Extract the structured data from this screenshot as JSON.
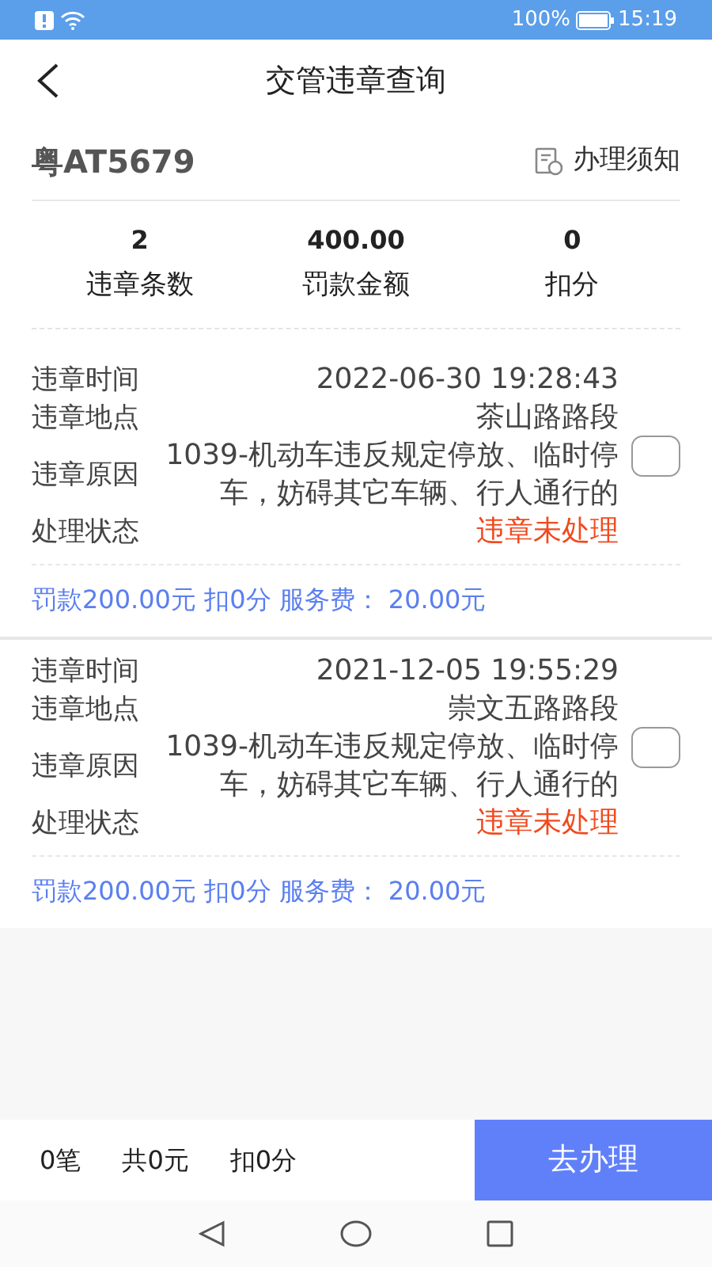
{
  "status_bar": {
    "battery_text": "100%",
    "time": "15:19"
  },
  "header": {
    "title": "交管违章查询"
  },
  "plate": {
    "number": "粤AT5679",
    "notice_link": "办理须知"
  },
  "summary": [
    {
      "value": "2",
      "label": "违章条数"
    },
    {
      "value": "400.00",
      "label": "罚款金额"
    },
    {
      "value": "0",
      "label": "扣分"
    }
  ],
  "violations": [
    {
      "checked": false,
      "fields": [
        {
          "label": "违章时间",
          "value": "2022-06-30 19:28:43",
          "kind": "plain"
        },
        {
          "label": "违章地点",
          "value": "茶山路路段",
          "kind": "plain"
        },
        {
          "label": "违章原因",
          "value": "1039-机动车违反规定停放、临时停车，妨碍其它车辆、行人通行的",
          "kind": "plain"
        },
        {
          "label": "处理状态",
          "value": "违章未处理",
          "kind": "alert"
        }
      ],
      "fee_line": "罚款200.00元 扣0分 服务费： 20.00元"
    },
    {
      "checked": false,
      "fields": [
        {
          "label": "违章时间",
          "value": "2021-12-05 19:55:29",
          "kind": "plain"
        },
        {
          "label": "违章地点",
          "value": "崇文五路路段",
          "kind": "plain"
        },
        {
          "label": "违章原因",
          "value": "1039-机动车违反规定停放、临时停车，妨碍其它车辆、行人通行的",
          "kind": "plain"
        },
        {
          "label": "处理状态",
          "value": "违章未处理",
          "kind": "alert"
        }
      ],
      "fee_line": "罚款200.00元 扣0分 服务费： 20.00元"
    }
  ],
  "footer": {
    "count": "0笔",
    "total": "共0元",
    "points": "扣0分",
    "button": "去办理"
  }
}
